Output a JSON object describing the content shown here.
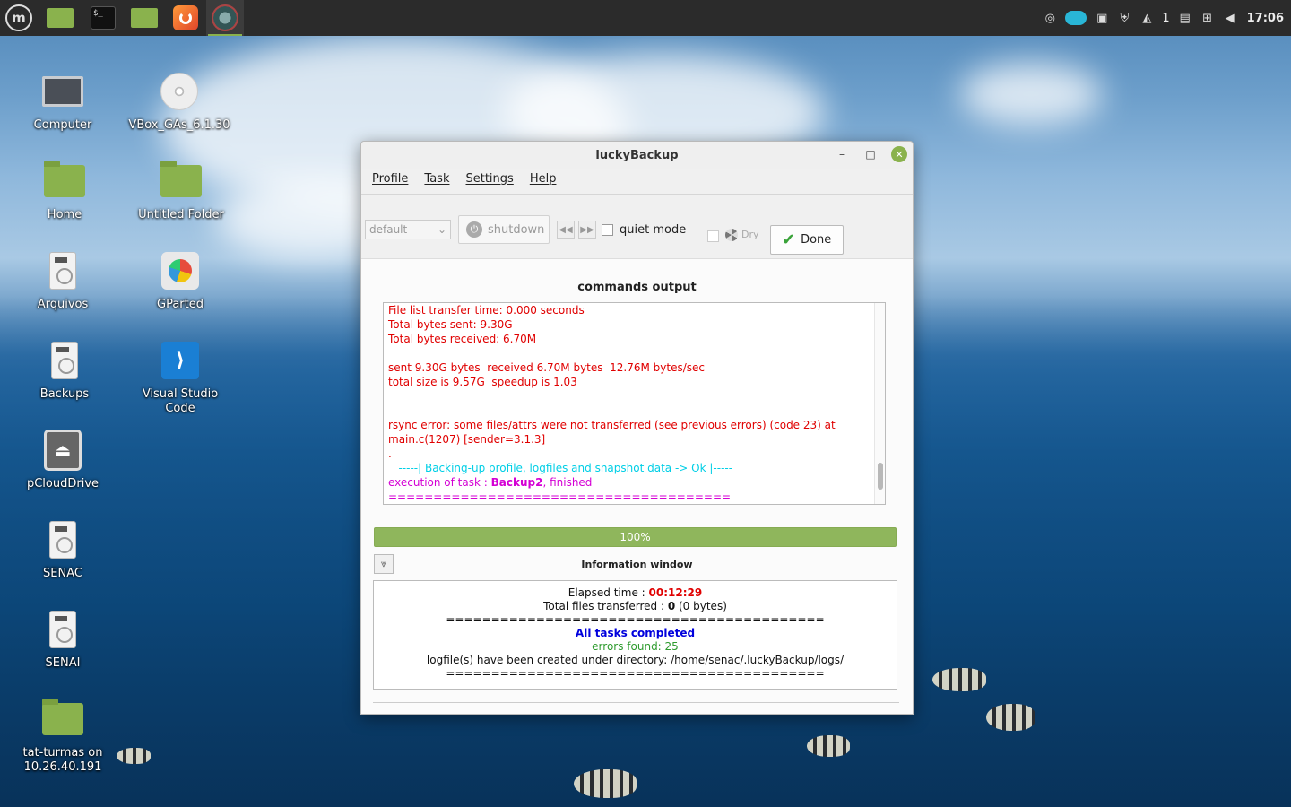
{
  "panel": {
    "launchers": [
      {
        "name": "menu-button",
        "icon": "mint-logo-icon"
      },
      {
        "name": "files-launcher",
        "icon": "folder-icon"
      },
      {
        "name": "terminal-launcher",
        "icon": "terminal-icon",
        "glyph": "$_"
      },
      {
        "name": "files-launcher-2",
        "icon": "folder-icon"
      },
      {
        "name": "firefox-launcher",
        "icon": "firefox-icon"
      },
      {
        "name": "luckybackup-task",
        "icon": "luckybackup-icon"
      }
    ],
    "tray": {
      "workspace_count": "1",
      "clock": "17:06"
    }
  },
  "desktop_icons": [
    {
      "label": "Computer",
      "icon": "monitor-icon"
    },
    {
      "label": "VBox_GAs_6.1.30",
      "icon": "disc-icon"
    },
    {
      "label": "Home",
      "icon": "home-folder-icon"
    },
    {
      "label": "Untitled Folder",
      "icon": "folder-icon"
    },
    {
      "label": "Arquivos",
      "icon": "drive-icon"
    },
    {
      "label": "GParted",
      "icon": "gparted-icon"
    },
    {
      "label": "Backups",
      "icon": "drive-icon"
    },
    {
      "label": "Visual Studio Code",
      "icon": "vscode-icon"
    },
    {
      "label": "pCloudDrive",
      "icon": "eject-icon"
    },
    {
      "label": "SENAC",
      "icon": "drive-icon"
    },
    {
      "label": "SENAI",
      "icon": "drive-icon"
    },
    {
      "label": "tat-turmas on 10.26.40.191",
      "icon": "network-folder-icon"
    }
  ],
  "window": {
    "title": "luckyBackup",
    "menu": [
      "Profile",
      "Task",
      "Settings",
      "Help"
    ],
    "toolbar": {
      "profile_combo": "default",
      "shutdown_label": "shutdown",
      "quiet_mode_label": "quiet mode",
      "dry_label": "Dry",
      "done_label": "Done"
    },
    "commands_output_title": "commands output",
    "output_lines": {
      "l1": "File list transfer time: 0.000 seconds",
      "l2": "Total bytes sent: 9.30G",
      "l3": "Total bytes received: 6.70M",
      "l4": "sent 9.30G bytes  received 6.70M bytes  12.76M bytes/sec",
      "l5": "total size is 9.57G  speedup is 1.03",
      "l6": "rsync error: some files/attrs were not transferred (see previous errors) (code 23) at main.c(1207) [sender=3.1.3]",
      "l7": ".",
      "l8": "   -----| Backing-up profile, logfiles and snapshot data -> Ok |-----",
      "l9_prefix": "execution of task : ",
      "l9_task": "Backup2",
      "l9_suffix": ", finished ======================================"
    },
    "progress": {
      "value": 100,
      "label": "100%"
    },
    "info_window_title": "Information window",
    "info": {
      "elapsed_label": "Elapsed time : ",
      "elapsed_value": "00:12:29",
      "files_label": "Total files transferred : ",
      "files_count": "0",
      "files_bytes": " (0 bytes)",
      "separator": "==========================================",
      "all_done": "All tasks completed",
      "errors": "errors found: 25",
      "logfile": "logfile(s) have been created under directory: /home/senac/.luckyBackup/logs/"
    }
  }
}
